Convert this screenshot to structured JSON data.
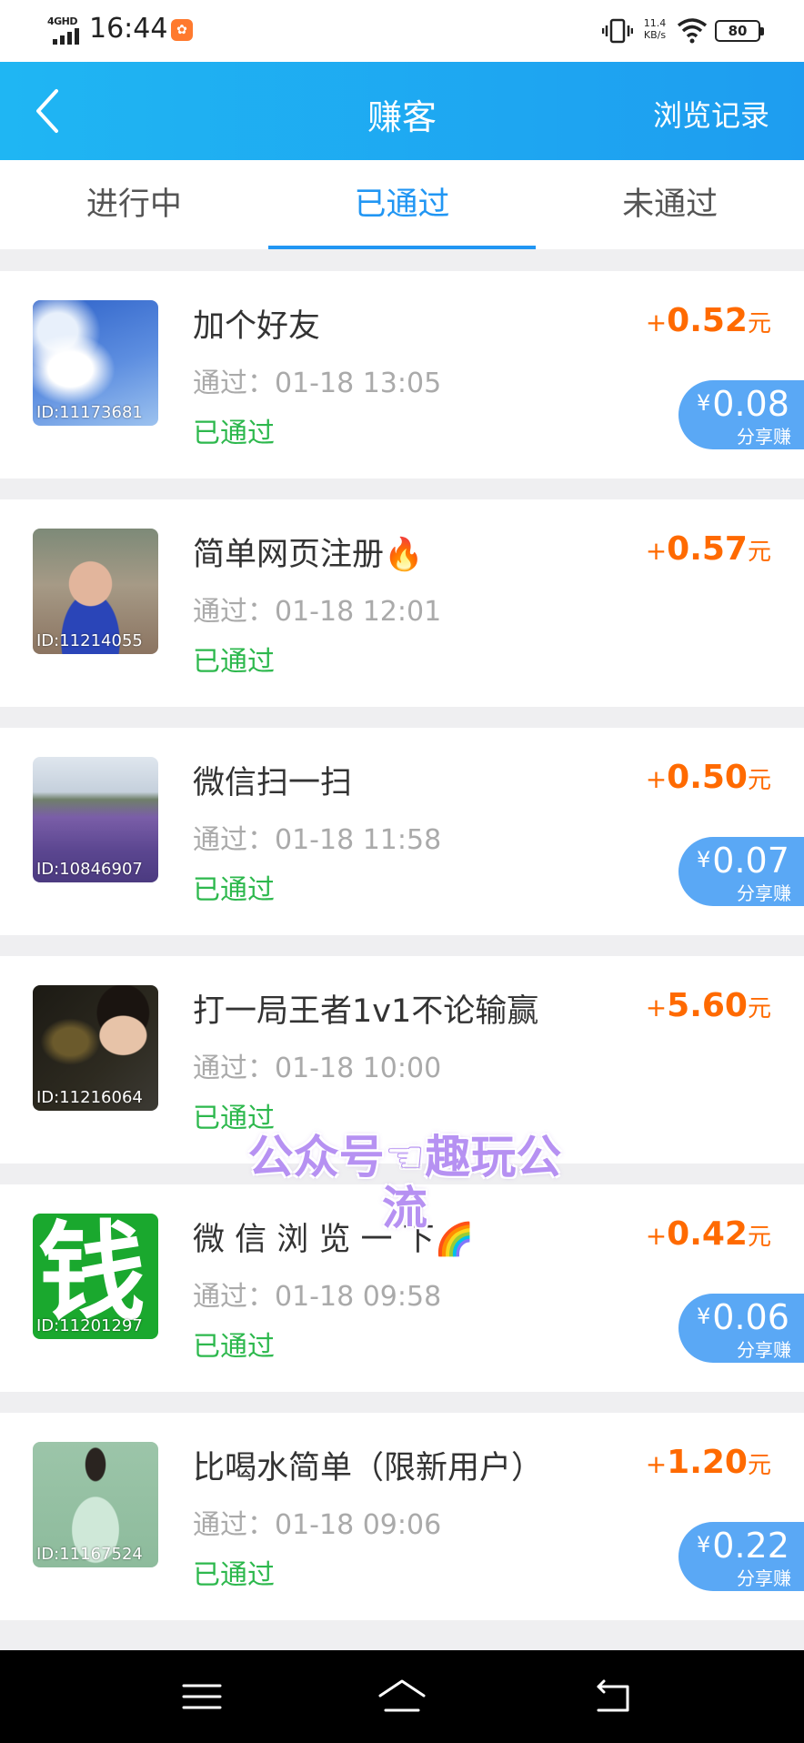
{
  "status_bar": {
    "network": "4GHD",
    "time": "16:44",
    "speed_value": "11.4",
    "speed_unit": "KB/s",
    "battery": "80"
  },
  "header": {
    "back_icon": "chevron-left-icon",
    "title": "赚客",
    "right_link": "浏览记录"
  },
  "tabs": [
    {
      "label": "进行中",
      "active": false
    },
    {
      "label": "已通过",
      "active": true
    },
    {
      "label": "未通过",
      "active": false
    }
  ],
  "tasks": [
    {
      "title": "加个好友",
      "id": "ID:11173681",
      "time": "通过：01-18 13:05",
      "status": "已通过",
      "plus": "+",
      "price": "0.52",
      "unit": "元",
      "share": "0.08",
      "share_label": "分享赚"
    },
    {
      "title": "简单网页注册🔥",
      "id": "ID:11214055",
      "time": "通过：01-18 12:01",
      "status": "已通过",
      "plus": "+",
      "price": "0.57",
      "unit": "元",
      "share": null,
      "share_label": null
    },
    {
      "title": "微信扫一扫",
      "id": "ID:10846907",
      "time": "通过：01-18 11:58",
      "status": "已通过",
      "plus": "+",
      "price": "0.50",
      "unit": "元",
      "share": "0.07",
      "share_label": "分享赚"
    },
    {
      "title": "打一局王者1v1不论输赢",
      "id": "ID:11216064",
      "time": "通过：01-18 10:00",
      "status": "已通过",
      "plus": "+",
      "price": "5.60",
      "unit": "元",
      "share": null,
      "share_label": null
    },
    {
      "title": "微 信 浏 览 一 下🌈",
      "id": "ID:11201297",
      "time": "通过：01-18 09:58",
      "status": "已通过",
      "plus": "+",
      "price": "0.42",
      "unit": "元",
      "share": "0.06",
      "share_label": "分享赚"
    },
    {
      "title": "比喝水简单（限新用户）",
      "id": "ID:11167524",
      "time": "通过：01-18 09:06",
      "status": "已通过",
      "plus": "+",
      "price": "1.20",
      "unit": "元",
      "share": "0.22",
      "share_label": "分享赚"
    }
  ],
  "currency_symbol": "¥",
  "thumb_text": {
    "qian": "钱"
  },
  "watermark": "公众号☜趣玩公流",
  "nav": {
    "menu_icon": "menu-icon",
    "home_icon": "home-icon",
    "back_icon": "back-icon"
  },
  "colors": {
    "header": "#1fb6f3",
    "accent": "#2196f3",
    "price": "#ff6a00",
    "status": "#2db84d",
    "share_badge": "#5aa8f5"
  }
}
